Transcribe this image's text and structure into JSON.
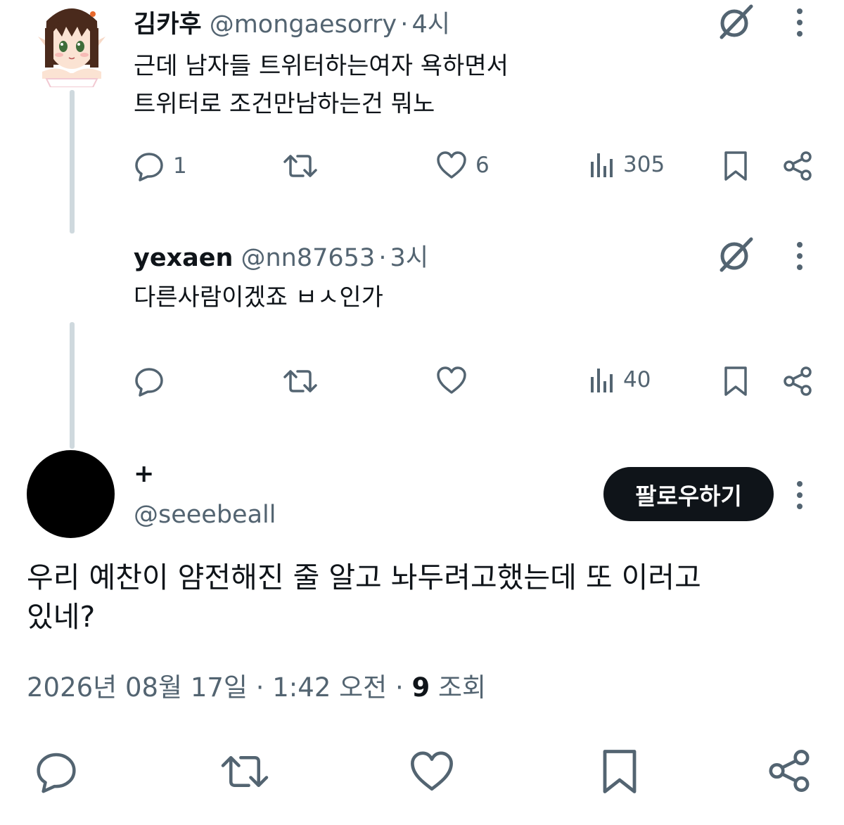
{
  "reply1": {
    "name": "김카후",
    "handle": "@mongaesorry",
    "dot": "·",
    "time": "4시",
    "text_line1": "근데 남자들 트위터하는여자 욕하면서",
    "text_line2": "트위터로 조건만남하는건 뭐노",
    "reply_count": "1",
    "like_count": "6",
    "view_count": "305"
  },
  "reply2": {
    "name": "yexaen",
    "handle": "@nn87653",
    "dot": "·",
    "time": "3시",
    "text": "다른사람이겠죠 ㅂㅅ인가",
    "view_count": "40"
  },
  "main": {
    "name": "+",
    "handle": "@seeebeall",
    "follow_label": "팔로우하기",
    "text_line1": "우리 예찬이 얌전해진 줄 알고 놔두려고했는데 또 이러고",
    "text_line2": "있네?",
    "date": "2026년 08월 17일",
    "dot": "·",
    "clock": "1:42 오전",
    "dot2": "·",
    "views": "9",
    "views_label": "조회"
  },
  "icons": [
    "grok-icon",
    "more-icon",
    "reply-icon",
    "retweet-icon",
    "like-icon",
    "views-icon",
    "bookmark-icon",
    "share-icon"
  ],
  "colors": {
    "text": "#0f1419",
    "secondary": "#536471",
    "thread": "#cfd9de",
    "button": "#0f1419"
  }
}
